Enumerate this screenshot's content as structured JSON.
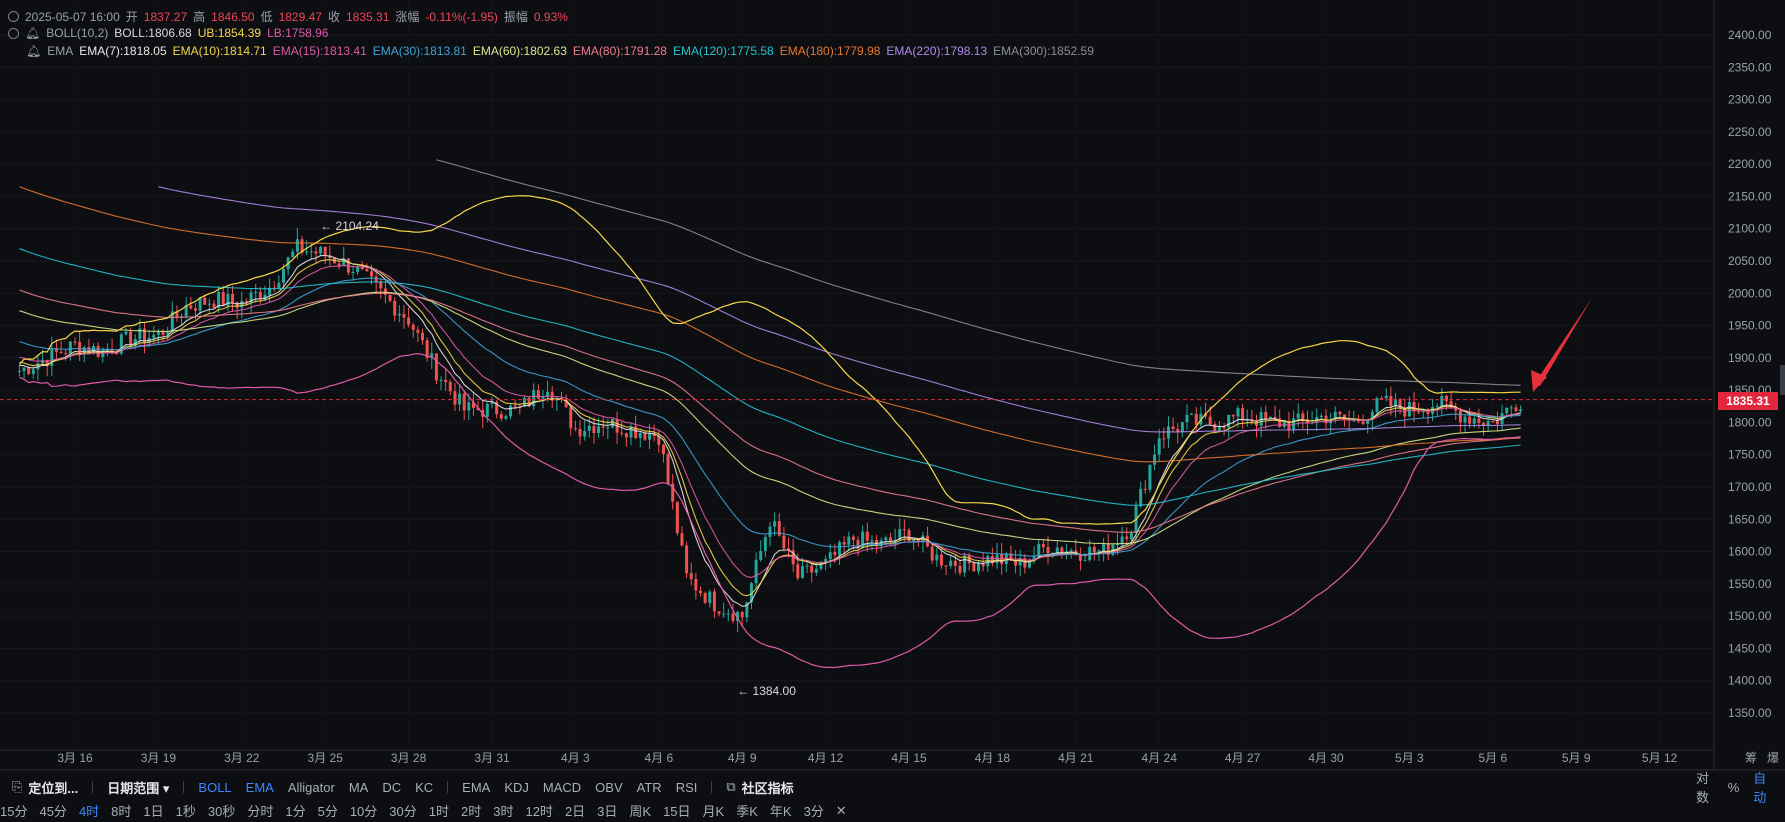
{
  "header": {
    "ohlc": {
      "date": "2025-05-07 16:00",
      "open_label": "开",
      "open": "1837.27",
      "high_label": "高",
      "high": "1846.50",
      "low_label": "低",
      "low": "1829.47",
      "close_label": "收",
      "close": "1835.31",
      "chg_label": "涨幅",
      "chg": "-0.11%(-1.95)",
      "amp_label": "振幅",
      "amp": "0.93%"
    },
    "boll": {
      "name": "BOLL(10,2)",
      "mid": "BOLL:1806.68",
      "ub": "UB:1854.39",
      "lb": "LB:1758.96"
    },
    "ema": {
      "name": "EMA",
      "items": [
        {
          "text": "EMA(7):1818.05",
          "color": "#e8e8e8"
        },
        {
          "text": "EMA(10):1814.71",
          "color": "#f5d84a"
        },
        {
          "text": "EMA(15):1813.41",
          "color": "#e05aa8"
        },
        {
          "text": "EMA(30):1813.81",
          "color": "#3fa3d8"
        },
        {
          "text": "EMA(60):1802.63",
          "color": "#d9e88a"
        },
        {
          "text": "EMA(80):1791.28",
          "color": "#f07c8f"
        },
        {
          "text": "EMA(120):1775.58",
          "color": "#22c3d3"
        },
        {
          "text": "EMA(180):1779.98",
          "color": "#e8772e"
        },
        {
          "text": "EMA(220):1798.13",
          "color": "#b08ae8"
        },
        {
          "text": "EMA(300):1852.59",
          "color": "#8c8f96"
        }
      ]
    }
  },
  "chart_data": {
    "type": "candlestick",
    "instrument_interval": "4时",
    "ylim": [
      1300,
      2420
    ],
    "y_ticks": [
      "2400.00",
      "2350.00",
      "2300.00",
      "2250.00",
      "2200.00",
      "2150.00",
      "2100.00",
      "2050.00",
      "2000.00",
      "1950.00",
      "1900.00",
      "1850.00",
      "1800.00",
      "1750.00",
      "1700.00",
      "1650.00",
      "1600.00",
      "1550.00",
      "1500.00",
      "1450.00",
      "1400.00",
      "1350.00"
    ],
    "x_ticks": [
      "3月 16",
      "3月 19",
      "3月 22",
      "3月 25",
      "3月 28",
      "3月 31",
      "4月 3",
      "4月 6",
      "4月 9",
      "4月 12",
      "4月 15",
      "4月 18",
      "4月 21",
      "4月 24",
      "4月 27",
      "4月 30",
      "5月 3",
      "5月 6",
      "5月 9",
      "5月 12"
    ],
    "close_series": {
      "x": [
        "3月 14",
        "3月 15",
        "3月 16",
        "3月 17",
        "3月 18",
        "3月 19",
        "3月 20",
        "3月 21",
        "3月 22",
        "3月 23",
        "3月 24",
        "3月 25",
        "3月 26",
        "3月 27",
        "3月 28",
        "3月 29",
        "3月 30",
        "3月 31",
        "4月 1",
        "4月 2",
        "4月 3",
        "4月 4",
        "4月 5",
        "4月 6",
        "4月 7",
        "4月 8",
        "4月 9",
        "4月 10",
        "4月 11",
        "4月 12",
        "4月 13",
        "4月 14",
        "4月 15",
        "4月 16",
        "4月 17",
        "4月 18",
        "4月 19",
        "4月 20",
        "4月 21",
        "4月 22",
        "4月 23",
        "4月 24",
        "4月 25",
        "4月 26",
        "4月 27",
        "4月 28",
        "4月 29",
        "4月 30",
        "5月 1",
        "5月 2",
        "5月 3",
        "5月 4",
        "5月 5",
        "5月 6",
        "5月 7"
      ],
      "values": [
        1880,
        1900,
        1920,
        1910,
        1930,
        1935,
        1980,
        1990,
        1985,
        2010,
        2070,
        2060,
        2040,
        2000,
        1960,
        1880,
        1820,
        1820,
        1820,
        1860,
        1790,
        1800,
        1790,
        1780,
        1560,
        1520,
        1500,
        1650,
        1560,
        1580,
        1620,
        1610,
        1630,
        1590,
        1580,
        1590,
        1580,
        1610,
        1600,
        1600,
        1640,
        1780,
        1800,
        1800,
        1810,
        1800,
        1800,
        1810,
        1800,
        1830,
        1820,
        1830,
        1810,
        1800,
        1835.31
      ]
    },
    "current_price": "1835.31",
    "annotations": [
      {
        "text": "← 2104.24",
        "x": "3月 25",
        "y": 2104.24
      },
      {
        "text": "← 1384.00",
        "x": "4月 9",
        "y": 1384.0
      }
    ],
    "grid": true,
    "legend": "top-left"
  },
  "toolbar": {
    "locate": "定位到...",
    "range": "日期范围",
    "main_indicators": [
      "BOLL",
      "EMA",
      "Alligator",
      "MA",
      "DC",
      "KC"
    ],
    "sub_indicators": [
      "EMA",
      "KDJ",
      "MACD",
      "OBV",
      "ATR",
      "RSI"
    ],
    "community": "社区指标",
    "right": [
      "对数",
      "%",
      "自动"
    ],
    "right_axis_buttons": [
      "筹",
      "爆"
    ]
  },
  "timeframes": [
    "15分",
    "45分",
    "4时",
    "8时",
    "1日",
    "1秒",
    "30秒",
    "分时",
    "1分",
    "5分",
    "10分",
    "30分",
    "1时",
    "2时",
    "3时",
    "12时",
    "2日",
    "3日",
    "周K",
    "15日",
    "月K",
    "季K",
    "年K",
    "3分"
  ],
  "active_timeframe": "4时",
  "colors": {
    "up": "#26a69a",
    "down": "#ef5350",
    "accent": "#3e86ff",
    "price_tag": "#e2273d",
    "bg": "#0d0e12"
  }
}
